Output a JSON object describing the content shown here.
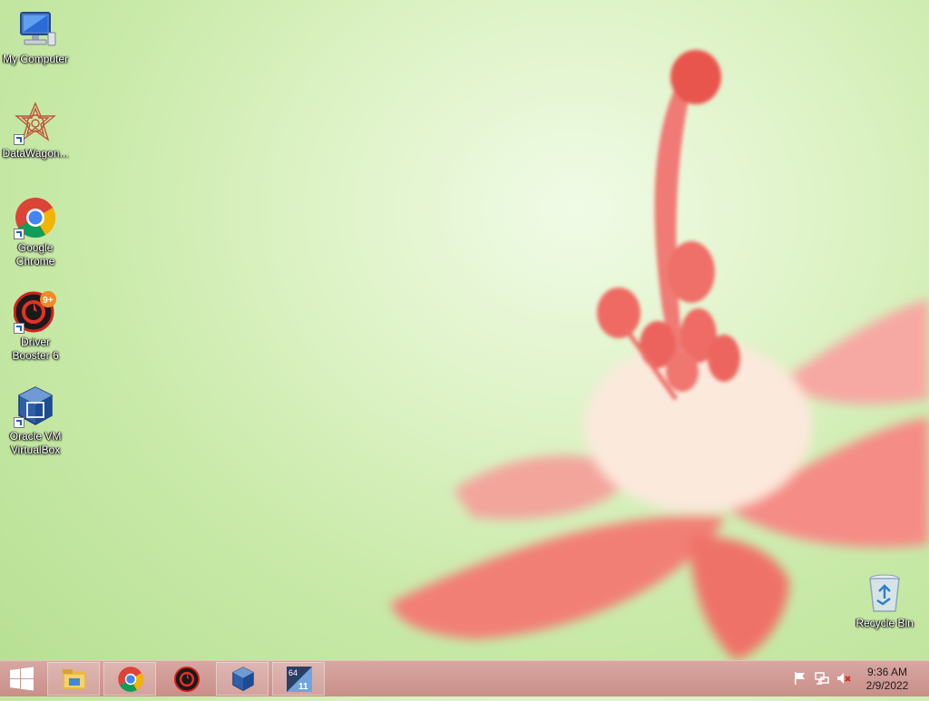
{
  "desktop": {
    "icons": [
      {
        "label": "My Computer"
      },
      {
        "label": "DataWagon..."
      },
      {
        "label": "Google Chrome"
      },
      {
        "label": "Driver Booster 6"
      },
      {
        "label": "Oracle VM VirtualBox"
      },
      {
        "label": "Recycle Bin"
      }
    ],
    "driver_booster_badge": "9+"
  },
  "taskbar": {
    "pinned": [
      "file-explorer-icon",
      "chrome-icon",
      "driver-booster-icon",
      "virtualbox-icon",
      "app-64-11-icon"
    ],
    "app_badge_top": "64",
    "app_badge_bottom": "11",
    "clock": {
      "time": "9:36 AM",
      "date": "2/9/2022"
    }
  },
  "colors": {
    "taskbar": "#c98f89",
    "wallpaper": "#c9eaa9",
    "flower": "#f27a70"
  }
}
